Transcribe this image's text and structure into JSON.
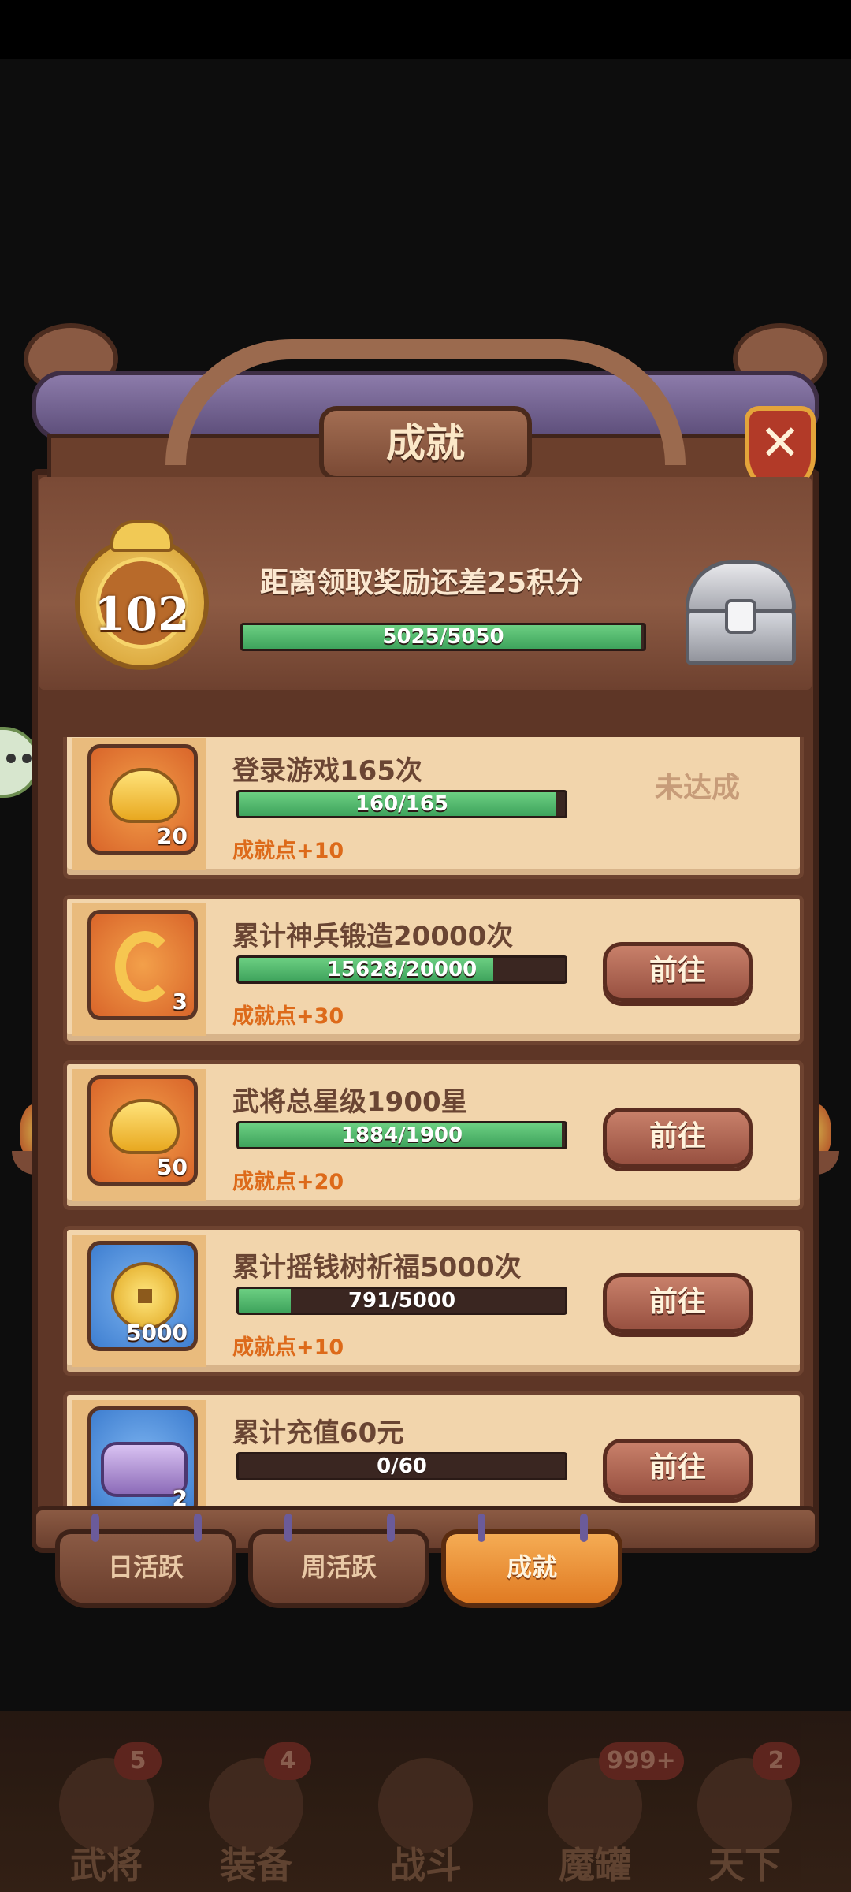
{
  "panel": {
    "title": "成就",
    "close_label": "✕"
  },
  "header": {
    "level": "102",
    "message": "距离领取奖励还差25积分",
    "progress_text": "5025/5050",
    "progress_fraction": 0.995
  },
  "achievements": [
    {
      "title": "登录游戏165次",
      "item_qty": "20",
      "item_icon": "gold-ingot-icon",
      "item_bg": "orange",
      "progress_text": "160/165",
      "progress_fraction": 0.97,
      "points": "成就点+10",
      "status": "未达成",
      "button": ""
    },
    {
      "title": "累计神兵锻造20000次",
      "item_qty": "3",
      "item_icon": "dragon-emblem-icon",
      "item_bg": "orange",
      "progress_text": "15628/20000",
      "progress_fraction": 0.78,
      "points": "成就点+30",
      "status": "",
      "button": "前往"
    },
    {
      "title": "武将总星级1900星",
      "item_qty": "50",
      "item_icon": "gold-ingot-icon",
      "item_bg": "orange",
      "progress_text": "1884/1900",
      "progress_fraction": 0.99,
      "points": "成就点+20",
      "status": "",
      "button": "前往"
    },
    {
      "title": "累计摇钱树祈福5000次",
      "item_qty": "5000",
      "item_icon": "coin-icon",
      "item_bg": "blue",
      "progress_text": "791/5000",
      "progress_fraction": 0.16,
      "points": "成就点+10",
      "status": "",
      "button": "前往"
    },
    {
      "title": "累计充值60元",
      "item_qty": "2",
      "item_icon": "food-tray-icon",
      "item_bg": "blue",
      "progress_text": "0/60",
      "progress_fraction": 0.0,
      "points": "",
      "status": "",
      "button": "前往"
    }
  ],
  "tabs": [
    {
      "label": "日活跃",
      "active": false
    },
    {
      "label": "周活跃",
      "active": false
    },
    {
      "label": "成就",
      "active": true
    }
  ],
  "bottom_nav": [
    {
      "label": "武将",
      "badge": "5"
    },
    {
      "label": "装备",
      "badge": "4"
    },
    {
      "label": "战斗",
      "badge": ""
    },
    {
      "label": "魔罐",
      "badge": "999+"
    },
    {
      "label": "天下",
      "badge": "2"
    }
  ],
  "colors": {
    "progress_fill": "#3ea35c",
    "points_text": "#dd6a1a",
    "active_tab": "#e07a22"
  }
}
